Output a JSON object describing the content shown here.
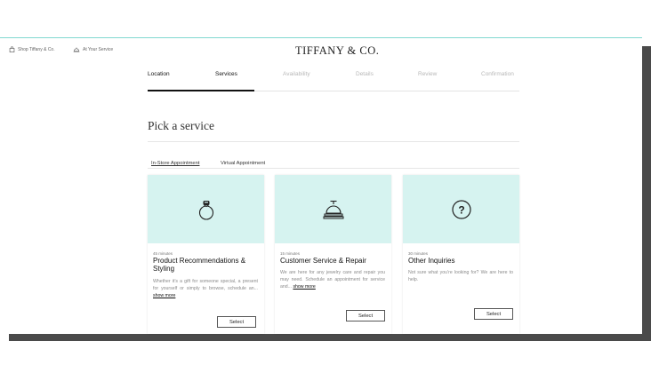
{
  "header": {
    "shop_link": "Shop Tiffany & Co.",
    "service_link": "At Your Service",
    "brand": "TIFFANY & CO."
  },
  "steps": [
    {
      "label": "Location",
      "state": "done"
    },
    {
      "label": "Services",
      "state": "done"
    },
    {
      "label": "Availability",
      "state": "todo"
    },
    {
      "label": "Details",
      "state": "todo"
    },
    {
      "label": "Review",
      "state": "todo"
    },
    {
      "label": "Confirmation",
      "state": "todo"
    }
  ],
  "page": {
    "title": "Pick a service"
  },
  "tabs": [
    {
      "label": "In-Store Appointment",
      "active": true
    },
    {
      "label": "Virtual Appointment",
      "active": false
    }
  ],
  "cards": [
    {
      "icon": "ring-icon",
      "duration": "45 minutes",
      "title": "Product Recommendations & Styling",
      "description": "Whether it’s a gift for someone special, a present for yourself or simply to browse, schedule an...",
      "show_more": "show more",
      "button": "Select"
    },
    {
      "icon": "service-bell-icon",
      "duration": "15 minutes",
      "title": "Customer Service & Repair",
      "description": "We are here for any jewelry care and repair you may need. Schedule an appointment for service and...",
      "show_more": "show more",
      "button": "Select"
    },
    {
      "icon": "question-mark-icon",
      "duration": "30 minutes",
      "title": "Other Inquiries",
      "description": "Not sure what you’re looking for? We are here to help.",
      "show_more": "",
      "button": "Select"
    }
  ],
  "colors": {
    "accent": "#81d8d0",
    "card_background": "#d6f3f0"
  }
}
